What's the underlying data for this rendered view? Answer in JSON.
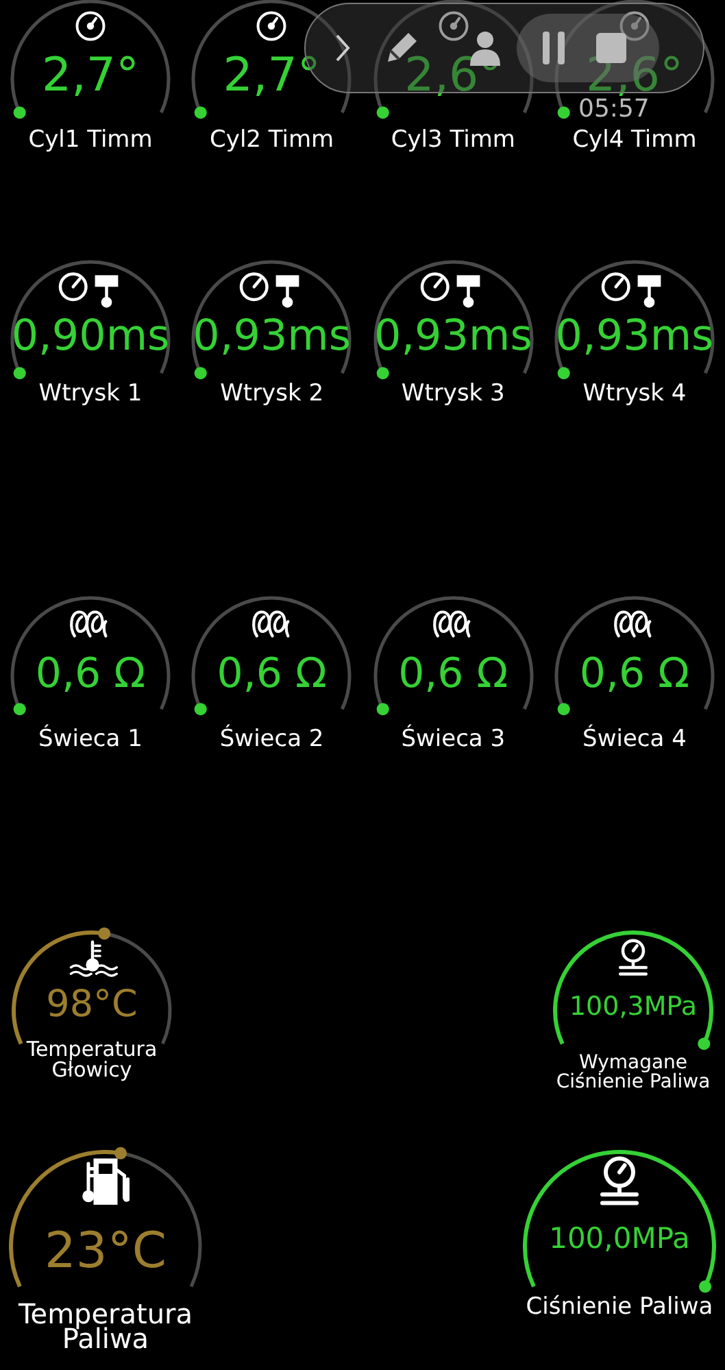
{
  "gauge_rows": [
    {
      "gauges": [
        {
          "kind": "timing",
          "value": "2,7°",
          "label": "Cyl1 Timm",
          "color": "#35d135"
        },
        {
          "kind": "timing",
          "value": "2,7°",
          "label": "Cyl2 Timm",
          "color": "#35d135"
        },
        {
          "kind": "timing",
          "value": "2,6°",
          "label": "Cyl3 Timm",
          "color": "#35d135"
        },
        {
          "kind": "timing",
          "value": "2,6°",
          "label": "Cyl4 Timm",
          "color": "#35d135"
        }
      ]
    },
    {
      "gauges": [
        {
          "kind": "injector",
          "value": "0,90ms",
          "label": "Wtrysk 1",
          "color": "#35d135"
        },
        {
          "kind": "injector",
          "value": "0,93ms",
          "label": "Wtrysk 2",
          "color": "#35d135"
        },
        {
          "kind": "injector",
          "value": "0,93ms",
          "label": "Wtrysk 3",
          "color": "#35d135"
        },
        {
          "kind": "injector",
          "value": "0,93ms",
          "label": "Wtrysk 4",
          "color": "#35d135"
        }
      ]
    },
    {
      "gauges": [
        {
          "kind": "glowplug",
          "value": "0,6 Ω",
          "label": "Świeca 1",
          "color": "#35d135"
        },
        {
          "kind": "glowplug",
          "value": "0,6 Ω",
          "label": "Świeca 2",
          "color": "#35d135"
        },
        {
          "kind": "glowplug",
          "value": "0,6 Ω",
          "label": "Świeca 3",
          "color": "#35d135"
        },
        {
          "kind": "glowplug",
          "value": "0,6 Ω",
          "label": "Świeca 4",
          "color": "#35d135"
        }
      ]
    },
    {
      "gauges": [
        {
          "kind": "coolant",
          "value": "98°C",
          "label": "Temperatura Głowicy",
          "level": 0.54,
          "color": "#9c7e2e"
        },
        {
          "kind": "pressure",
          "value": "100,3MPa",
          "label": "Wymagane Ciśnienie Paliwa",
          "level": 1,
          "color": "#35d135"
        }
      ]
    },
    {
      "gauges": [
        {
          "kind": "fuel_temp",
          "value": "23°C",
          "label": "Temperatura Paliwa",
          "level": 0.54,
          "color": "#9c7e2e"
        },
        {
          "kind": "pressure",
          "value": "100,0MPa",
          "label": "Ciśnienie Paliwa",
          "level": 1,
          "color": "#35d135"
        }
      ]
    }
  ],
  "overlay": {
    "time": "05:57"
  }
}
